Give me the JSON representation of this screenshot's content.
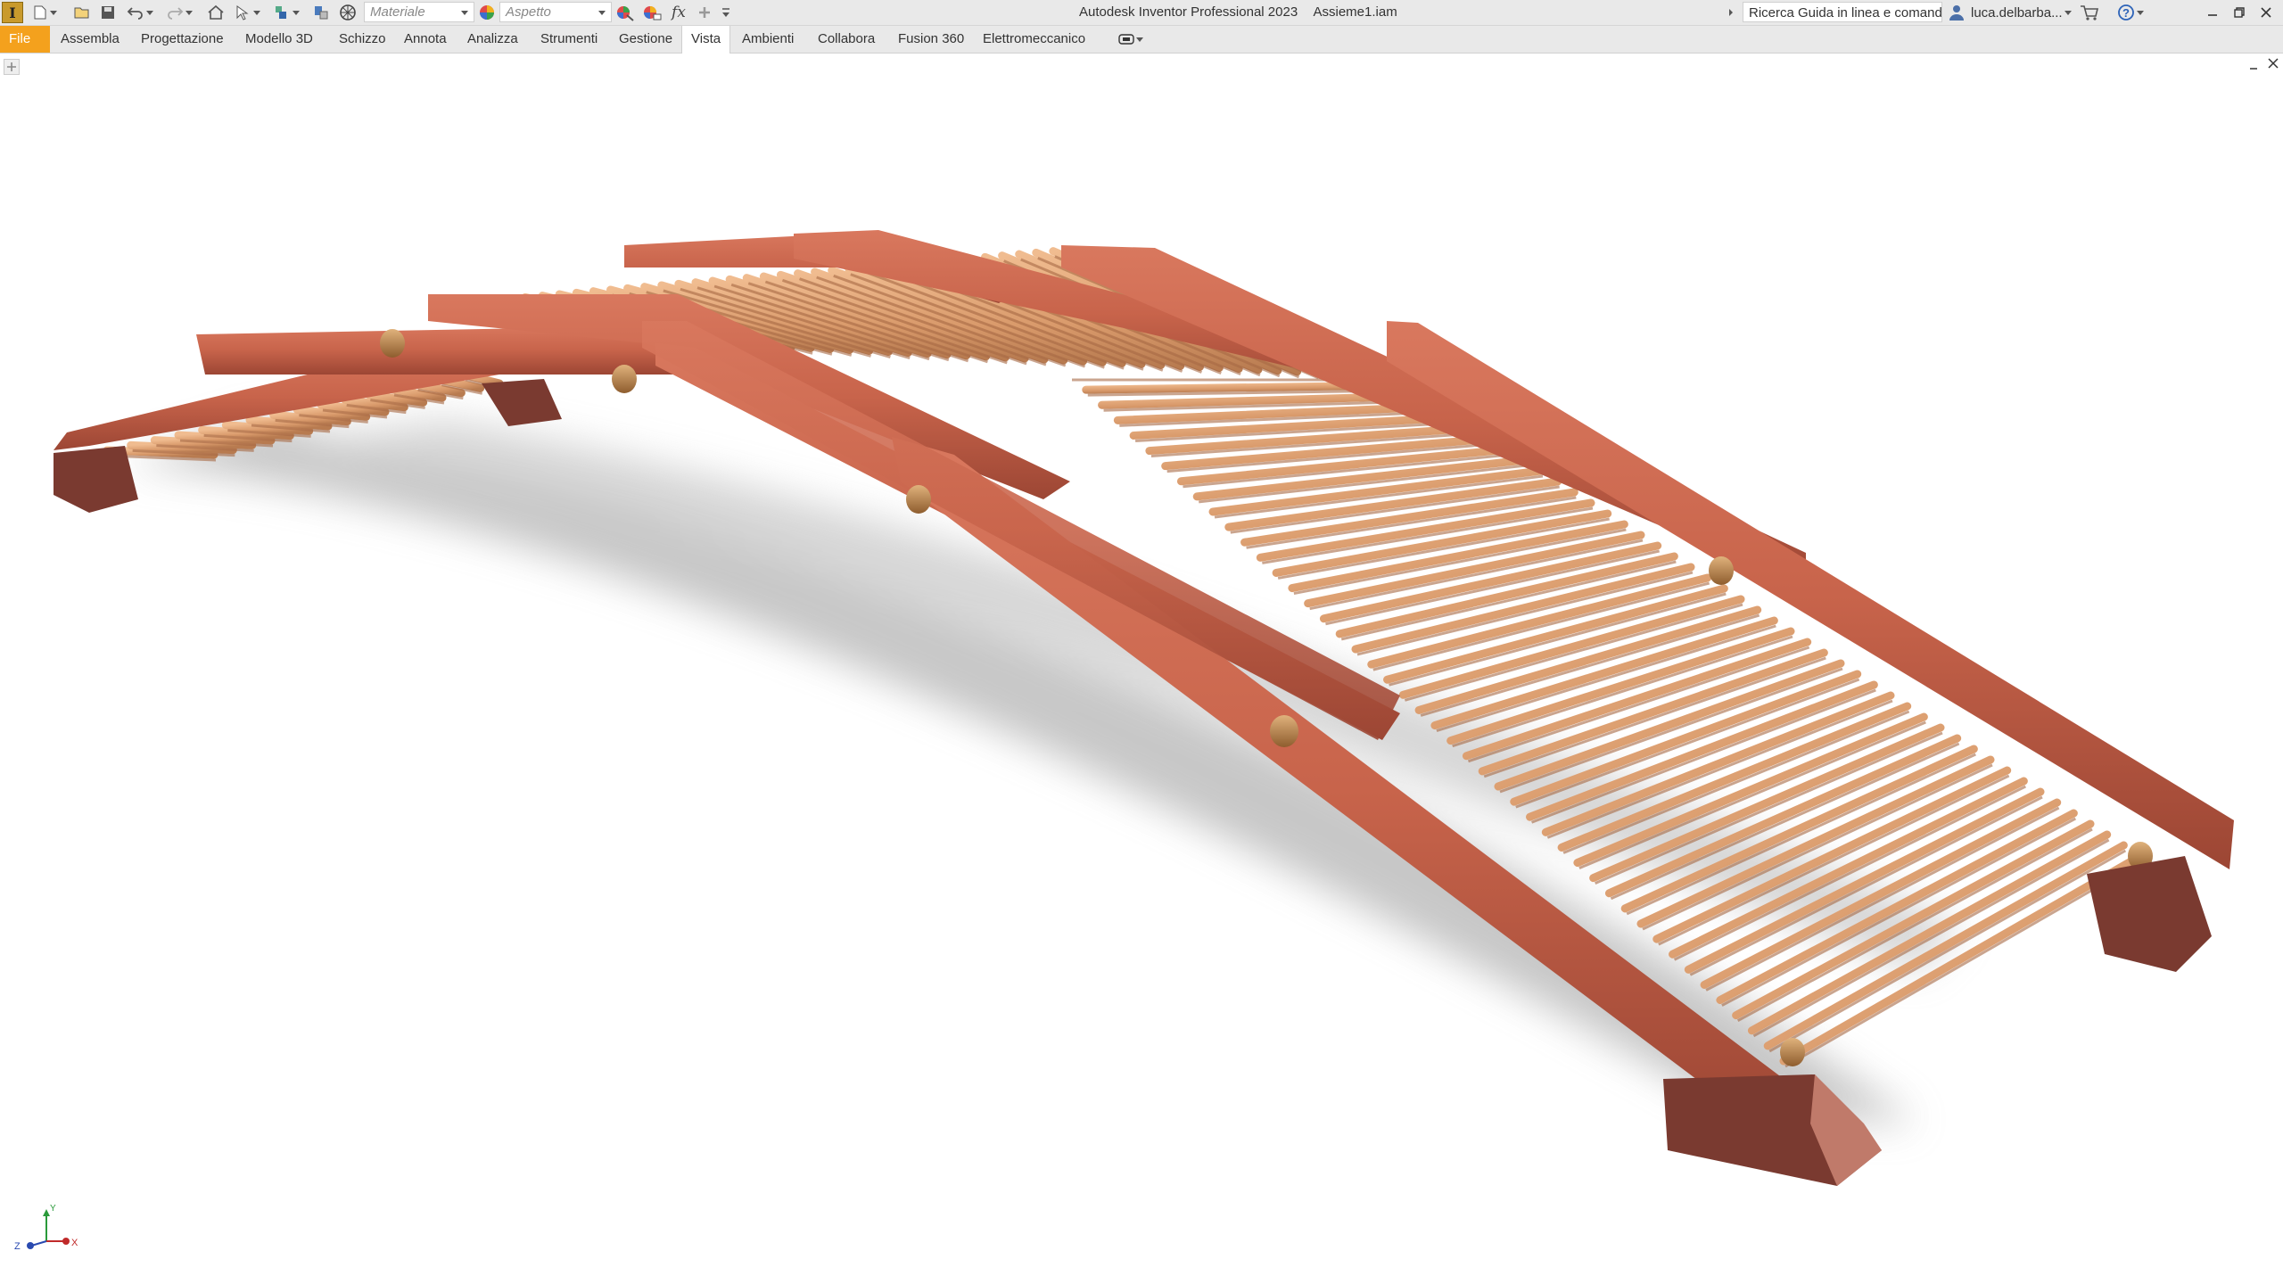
{
  "app": {
    "title": "Autodesk Inventor Professional 2023",
    "document": "Assieme1.iam",
    "logo_letter": "I"
  },
  "quick_access": {
    "material_placeholder": "Materiale",
    "appearance_placeholder": "Aspetto",
    "fx_label": "fx"
  },
  "search": {
    "placeholder": "Ricerca Guida in linea e comand"
  },
  "user": {
    "name": "luca.delbarba..."
  },
  "tabs": [
    {
      "label": "File"
    },
    {
      "label": "Assembla"
    },
    {
      "label": "Progettazione"
    },
    {
      "label": "Modello 3D"
    },
    {
      "label": "Schizzo"
    },
    {
      "label": "Annota"
    },
    {
      "label": "Analizza"
    },
    {
      "label": "Strumenti"
    },
    {
      "label": "Gestione"
    },
    {
      "label": "Vista"
    },
    {
      "label": "Ambienti"
    },
    {
      "label": "Collabora"
    },
    {
      "label": "Fusion 360"
    },
    {
      "label": "Elettromeccanico"
    }
  ],
  "active_tab": "Vista",
  "triad": {
    "x": "X",
    "y": "Y",
    "z": "Z"
  },
  "colors": {
    "file_tab": "#f4a11d",
    "beam": "#c8644b",
    "beam_dark": "#8e3d2c",
    "slat": "#e2a679",
    "slat_dark": "#a86a45",
    "foot": "#7a3a30"
  },
  "icons": [
    "app-logo-icon",
    "new-file-icon",
    "open-file-icon",
    "save-icon",
    "undo-icon",
    "redo-icon",
    "home-icon",
    "select-icon",
    "project-icon",
    "update-icon",
    "appearance-icon",
    "adjust-icon",
    "clear-override-icon",
    "parameters-icon",
    "add-icon",
    "customize-icon",
    "help-search-icon",
    "user-icon",
    "cart-icon",
    "help-icon",
    "minimize-icon",
    "restore-icon",
    "close-icon",
    "new-tab-icon",
    "viewport-minimize-icon",
    "viewport-close-icon"
  ]
}
